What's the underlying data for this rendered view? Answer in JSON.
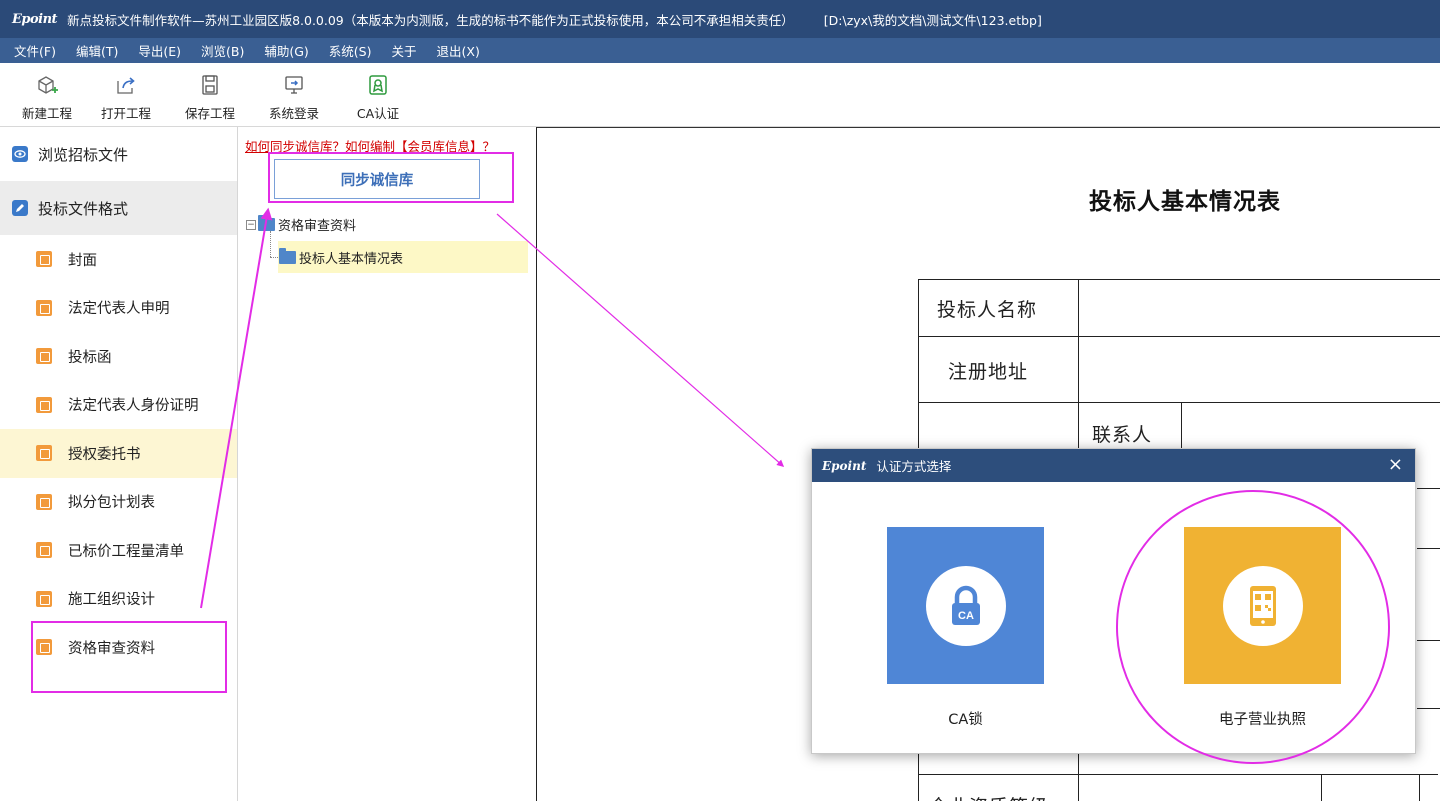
{
  "titlebar": {
    "logo": "Epoint",
    "title": "新点投标文件制作软件—苏州工业园区版8.0.0.09（本版本为内测版，生成的标书不能作为正式投标使用，本公司不承担相关责任）",
    "path": "[D:\\zyx\\我的文档\\测试文件\\123.etbp]"
  },
  "menu": [
    "文件(F)",
    "编辑(T)",
    "导出(E)",
    "浏览(B)",
    "辅助(G)",
    "系统(S)",
    "关于",
    "退出(X)"
  ],
  "toolbar": {
    "items": [
      {
        "label": "新建工程",
        "icon": "new-project-icon"
      },
      {
        "label": "打开工程",
        "icon": "open-project-icon"
      },
      {
        "label": "保存工程",
        "icon": "save-icon"
      },
      {
        "label": "系统登录",
        "icon": "login-icon"
      },
      {
        "label": "CA认证",
        "icon": "ca-cert-icon"
      }
    ]
  },
  "sidebar": {
    "browse": "浏览招标文件",
    "format": "投标文件格式",
    "items": [
      {
        "label": "封面"
      },
      {
        "label": "法定代表人申明"
      },
      {
        "label": "投标函"
      },
      {
        "label": "法定代表人身份证明"
      },
      {
        "label": "授权委托书"
      },
      {
        "label": "拟分包计划表"
      },
      {
        "label": "已标价工程量清单"
      },
      {
        "label": "施工组织设计"
      },
      {
        "label": "资格审查资料"
      }
    ]
  },
  "middle": {
    "help_link": "如何同步诚信库？如何编制【会员库信息】？",
    "sync_button": "同步诚信库",
    "tree_root": "资格审查资料",
    "tree_child": "投标人基本情况表"
  },
  "document": {
    "title": "投标人基本情况表",
    "rows": [
      "投标人名称",
      "注册地址",
      "联系人"
    ],
    "bottom_partial": "企业资质等级"
  },
  "dialog": {
    "logo": "Epoint",
    "title": "认证方式选择",
    "close": "×",
    "options": [
      {
        "label": "CA锁",
        "icon": "ca-lock-icon",
        "color": "#4f86d6",
        "badge": "CA"
      },
      {
        "label": "电子营业执照",
        "icon": "mobile-qr-icon",
        "color": "#f0b233"
      }
    ]
  },
  "colors": {
    "titlebar": "#2b4a78",
    "menubar": "#3a5f93",
    "annotation": "#e22ce6"
  }
}
